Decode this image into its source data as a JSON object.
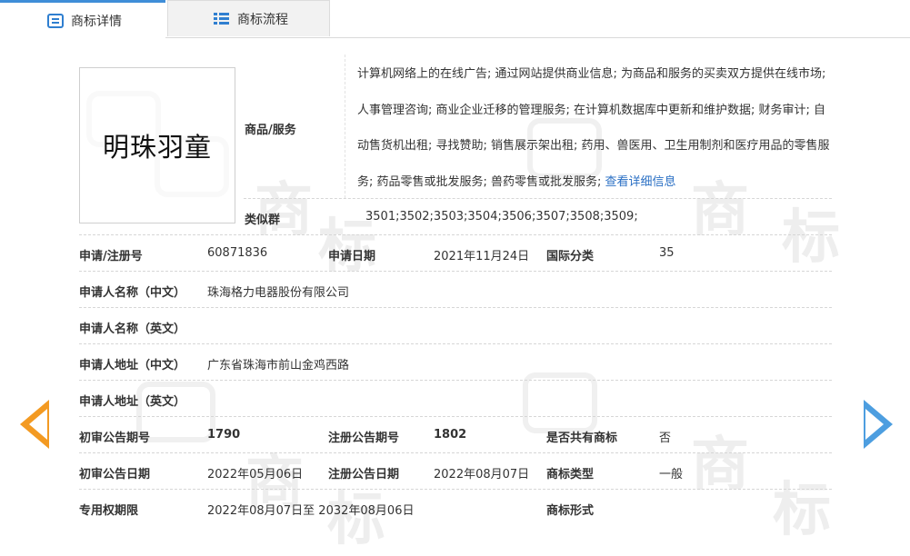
{
  "tabs": [
    {
      "label": "商标详情",
      "icon": "document-icon",
      "active": true
    },
    {
      "label": "商标流程",
      "icon": "list-icon",
      "active": false
    }
  ],
  "trademark": {
    "name": "明珠羽童"
  },
  "goods": {
    "label": "商品/服务",
    "text": "计算机网络上的在线广告; 通过网站提供商业信息; 为商品和服务的买卖双方提供在线市场; 人事管理咨询; 商业企业迁移的管理服务; 在计算机数据库中更新和维护数据; 财务审计; 自动售货机出租; 寻找赞助; 销售展示架出租; 药用、兽医用、卫生用制剂和医疗用品的零售服务; 药品零售或批发服务; 兽药零售或批发服务; ",
    "more_link": "查看详细信息"
  },
  "similar_group": {
    "label": "类似群",
    "value": "3501;3502;3503;3504;3506;3507;3508;3509;"
  },
  "rows": {
    "reg_no_label": "申请/注册号",
    "reg_no": "60871836",
    "apply_date_label": "申请日期",
    "apply_date": "2021年11月24日",
    "intl_class_label": "国际分类",
    "intl_class": "35",
    "applicant_cn_label": "申请人名称（中文）",
    "applicant_cn": "珠海格力电器股份有限公司",
    "applicant_en_label": "申请人名称（英文）",
    "applicant_en": "",
    "address_cn_label": "申请人地址（中文）",
    "address_cn": "广东省珠海市前山金鸡西路",
    "address_en_label": "申请人地址（英文）",
    "address_en": "",
    "prelim_no_label": "初审公告期号",
    "prelim_no": "1790",
    "reg_pub_no_label": "注册公告期号",
    "reg_pub_no": "1802",
    "shared_label": "是否共有商标",
    "shared": "否",
    "prelim_date_label": "初审公告日期",
    "prelim_date": "2022年05月06日",
    "reg_pub_date_label": "注册公告日期",
    "reg_pub_date": "2022年08月07日",
    "tm_type_label": "商标类型",
    "tm_type": "一般",
    "validity_label": "专用权期限",
    "validity": "2022年08月07日至 2032年08月06日",
    "tm_form_label": "商标形式",
    "tm_form": ""
  },
  "colors": {
    "accent": "#3f8ed8",
    "link": "#2a6fc4",
    "prev_arrow": "#f39a22",
    "next_arrow": "#4d9ee0"
  }
}
